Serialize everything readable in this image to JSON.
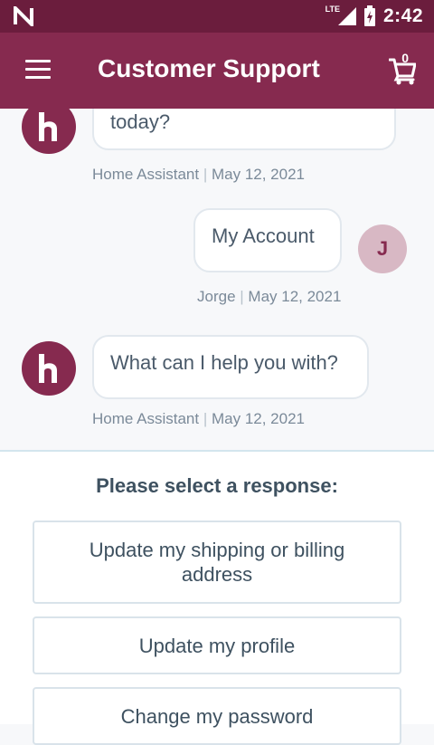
{
  "status_bar": {
    "time": "2:42",
    "network": "LTE"
  },
  "app_bar": {
    "title": "Customer Support",
    "cart_count": "0"
  },
  "messages": [
    {
      "from": "assistant",
      "avatar": "h",
      "text": "today?",
      "sender": "Home Assistant",
      "date": "May 12, 2021"
    },
    {
      "from": "user",
      "avatar": "J",
      "text": "My Account",
      "sender": "Jorge",
      "date": "May 12, 2021"
    },
    {
      "from": "assistant",
      "avatar": "h",
      "text": "What can I help you with?",
      "sender": "Home Assistant",
      "date": "May 12, 2021"
    }
  ],
  "response": {
    "prompt": "Please select a response:",
    "options": [
      "Update my shipping or billing address",
      "Update my profile",
      "Change my password"
    ]
  },
  "colors": {
    "primary": "#862a4f",
    "status": "#6b1d3d",
    "user_avatar": "#d8b8c4"
  }
}
